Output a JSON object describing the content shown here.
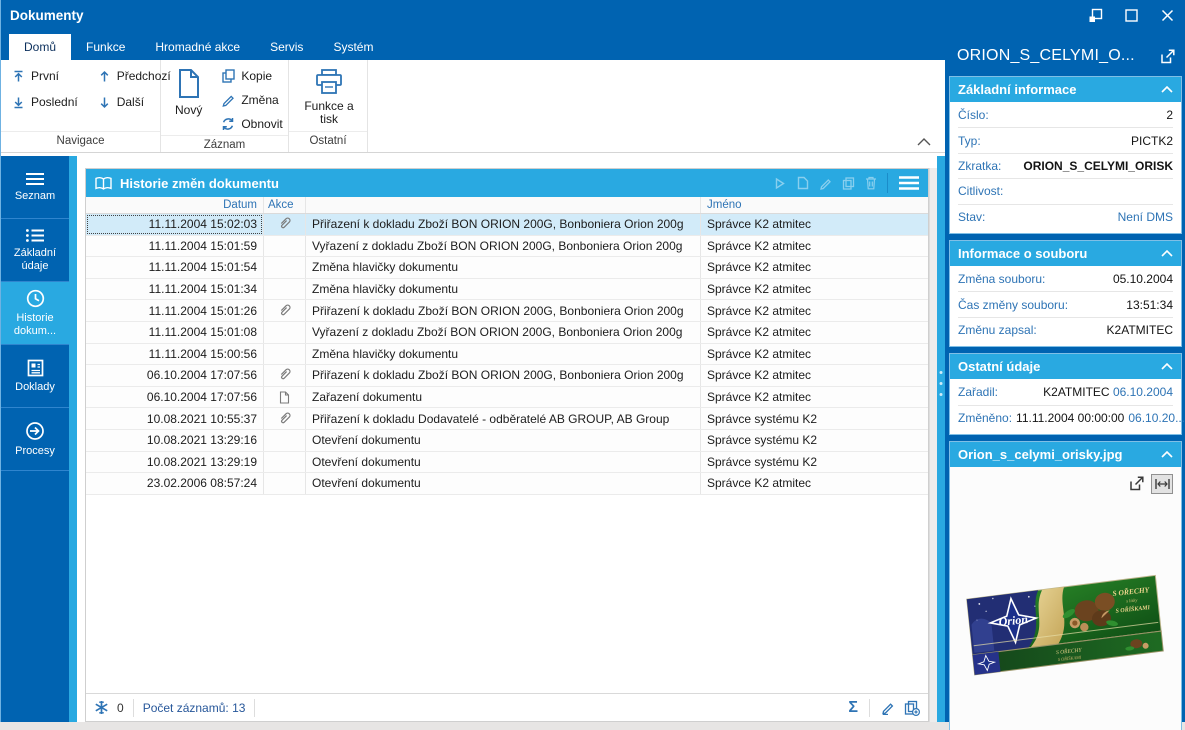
{
  "window": {
    "title": "Dokumenty"
  },
  "tabs": {
    "items": [
      "Domů",
      "Funkce",
      "Hromadné akce",
      "Servis",
      "Systém"
    ],
    "active": "Domů"
  },
  "ribbon": {
    "navigace": {
      "label": "Navigace",
      "first": "První",
      "last": "Poslední",
      "prev": "Předchozí",
      "next": "Další"
    },
    "zaznam": {
      "label": "Záznam",
      "new": "Nový",
      "copy": "Kopie",
      "change": "Změna",
      "refresh": "Obnovit"
    },
    "ostatni": {
      "label": "Ostatní",
      "print": "Funkce a tisk"
    }
  },
  "sidebar": {
    "items": [
      {
        "label": "Seznam",
        "icon": "menu-icon"
      },
      {
        "label": "Základní údaje",
        "icon": "list-icon"
      },
      {
        "label": "Historie dokum...",
        "icon": "clock-icon",
        "active": true
      },
      {
        "label": "Doklady",
        "icon": "document-icon"
      },
      {
        "label": "Procesy",
        "icon": "process-icon"
      }
    ]
  },
  "table": {
    "title": "Historie změn dokumentu",
    "toolbar_icons": [
      "play-icon",
      "new-doc-icon",
      "edit-icon",
      "copy-icon",
      "delete-icon",
      "menu-icon"
    ],
    "columns": {
      "datum": "Datum",
      "akce": "Akce",
      "jmeno": "Jméno"
    },
    "rows": [
      {
        "datum": "11.11.2004 15:02:03",
        "icon": "paperclip",
        "akce": "Přiřazení k dokladu Zboží BON ORION 200G, Bonboniera Orion 200g",
        "jmeno": "Správce K2 atmitec",
        "selected": true
      },
      {
        "datum": "11.11.2004 15:01:59",
        "icon": "",
        "akce": "Vyřazení z dokladu Zboží BON ORION 200G, Bonboniera Orion 200g",
        "jmeno": "Správce K2 atmitec"
      },
      {
        "datum": "11.11.2004 15:01:54",
        "icon": "",
        "akce": "Změna hlavičky dokumentu",
        "jmeno": "Správce K2 atmitec"
      },
      {
        "datum": "11.11.2004 15:01:34",
        "icon": "",
        "akce": "Změna hlavičky dokumentu",
        "jmeno": "Správce K2 atmitec"
      },
      {
        "datum": "11.11.2004 15:01:26",
        "icon": "paperclip",
        "akce": "Přiřazení k dokladu Zboží BON ORION 200G, Bonboniera Orion 200g",
        "jmeno": "Správce K2 atmitec"
      },
      {
        "datum": "11.11.2004 15:01:08",
        "icon": "",
        "akce": "Vyřazení z dokladu Zboží BON ORION 200G, Bonboniera Orion 200g",
        "jmeno": "Správce K2 atmitec"
      },
      {
        "datum": "11.11.2004 15:00:56",
        "icon": "",
        "akce": "Změna hlavičky dokumentu",
        "jmeno": "Správce K2 atmitec"
      },
      {
        "datum": "06.10.2004 17:07:56",
        "icon": "paperclip",
        "akce": "Přiřazení k dokladu Zboží BON ORION 200G, Bonboniera Orion 200g",
        "jmeno": "Správce K2 atmitec"
      },
      {
        "datum": "06.10.2004 17:07:56",
        "icon": "document",
        "akce": "Zařazení dokumentu",
        "jmeno": "Správce K2 atmitec"
      },
      {
        "datum": "10.08.2021 10:55:37",
        "icon": "paperclip",
        "akce": "Přiřazení k dokladu Dodavatelé - odběratelé AB GROUP, AB Group",
        "jmeno": "Správce systému K2"
      },
      {
        "datum": "10.08.2021 13:29:16",
        "icon": "",
        "akce": "Otevření dokumentu",
        "jmeno": "Správce systému K2"
      },
      {
        "datum": "10.08.2021 13:29:19",
        "icon": "",
        "akce": "Otevření dokumentu",
        "jmeno": "Správce systému K2"
      },
      {
        "datum": "23.02.2006 08:57:24",
        "icon": "",
        "akce": "Otevření dokumentu",
        "jmeno": "Správce K2 atmitec"
      }
    ],
    "footer": {
      "flag": "0",
      "count": "Počet záznamů: 13"
    }
  },
  "panel": {
    "title": "ORION_S_CELYMI_O...",
    "zakladni": {
      "title": "Základní informace",
      "cislo_label": "Číslo:",
      "cislo": "2",
      "typ_label": "Typ:",
      "typ": "PICTK2",
      "zkratka_label": "Zkratka:",
      "zkratka": "ORION_S_CELYMI_ORISK",
      "citlivost_label": "Citlivost:",
      "citlivost": "",
      "stav_label": "Stav:",
      "stav": "Není DMS"
    },
    "soubor": {
      "title": "Informace o souboru",
      "zmena_label": "Změna souboru:",
      "zmena": "05.10.2004",
      "cas_label": "Čas změny souboru:",
      "cas": "13:51:34",
      "zapsal_label": "Změnu zapsal:",
      "zapsal": "K2ATMITEC"
    },
    "ostatni": {
      "title": "Ostatní údaje",
      "zaradil_label": "Zařadil:",
      "zaradil_user": "K2ATMITEC",
      "zaradil_date": "06.10.2004",
      "zmeneno_label": "Změněno:",
      "zmeneno_value": "11.11.2004 00:00:00",
      "zmeneno_date": "06.10.20..."
    },
    "image": {
      "title": "Orion_s_celymi_orisky.jpg",
      "brand": "Orion",
      "text_top": "S OŘECHY",
      "text_mid": "s lísky",
      "text_bottom": "S OŘÍŠKAMI"
    }
  },
  "colors": {
    "dark_blue": "#0063B1",
    "azure": "#29A9E1",
    "label_blue": "#2E74B5",
    "selected_row": "#D2EBF9"
  }
}
